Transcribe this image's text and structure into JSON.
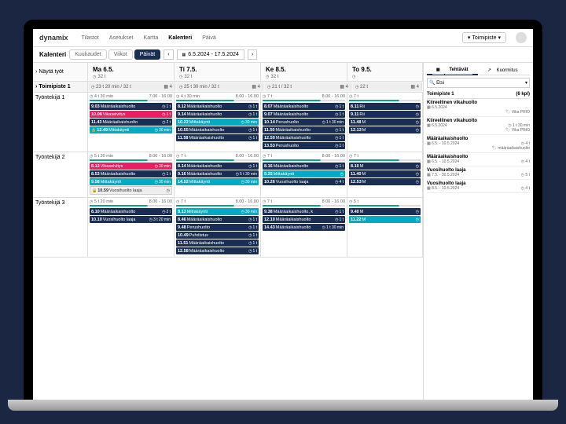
{
  "logo": "dynamix",
  "topnav": [
    "Tilastot",
    "Asetukset",
    "Kartta",
    "Kalenteri",
    "Päivä"
  ],
  "topnav_active": 3,
  "toimipiste_btn": "Toimipiste",
  "subbar": {
    "title": "Kalenteri",
    "tabs": [
      "Kuukaudet",
      "Viikot",
      "Päivät"
    ],
    "active": 2,
    "date": "6.5.2024 - 17.5.2024"
  },
  "show_label": "Näytä työt",
  "side": {
    "tabs": [
      "Tehtävät",
      "Kuormitus"
    ],
    "search": "Etsi",
    "hdr": {
      "name": "Toimipiste 1",
      "count": "(6 kpl)"
    },
    "items": [
      {
        "t": "Kiireellinen vikahuolto",
        "d": "6.5.2024",
        "b": "Vika PRIO"
      },
      {
        "t": "Kiireellinen vikahuolto",
        "d": "6.5.2024",
        "dur": "1 t 30 min",
        "b": "Vika PRIO"
      },
      {
        "t": "Määräaikaishuolto",
        "d": "6.5. - 10.5.2024",
        "dur": "4 t",
        "b": "määräaikaishuolto"
      },
      {
        "t": "Määräaikaishuolto",
        "d": "6.5. - 10.5.2024",
        "dur": "4 t"
      },
      {
        "t": "Vuosihuolto laaja",
        "d": "7.5. - 30.5.2024",
        "dur": "5 t"
      },
      {
        "t": "Vuosihuolto laaja",
        "d": "8.5. - 10.5.2024",
        "dur": "4 t"
      }
    ]
  },
  "days": [
    {
      "name": "Ma 6.5.",
      "time": "32 t"
    },
    {
      "name": "Ti 7.5.",
      "time": "32 t"
    },
    {
      "name": "Ke 8.5.",
      "time": "32 t"
    },
    {
      "name": "To 9.5.",
      "time": ""
    }
  ],
  "location": "Toimipiste 1",
  "stats": [
    "23 t 20 min / 32 t",
    "25 t 30 min / 32 t",
    "21 t / 32 t",
    "22 t"
  ],
  "stats_icon": "4",
  "workers": [
    {
      "name": "Työntekijä 1",
      "cols": [
        {
          "hdr": "4 t 30 min   7.00 - 16.00",
          "tasks": [
            {
              "tm": "9.03",
              "n": "Määräaikaishuolto",
              "d": "1 t",
              "c": "navy"
            },
            {
              "tm": "10.08",
              "n": "Vikaselvitys",
              "d": "1 t",
              "c": "pink"
            },
            {
              "tm": "11.43",
              "n": "Määräaikaishuolto",
              "d": "2 t",
              "c": "navy"
            },
            {
              "tm": "13.49",
              "n": "Mittakäynti",
              "d": "30 min",
              "c": "teal",
              "lock": true
            }
          ]
        },
        {
          "hdr": "4 t 30 min   8.00 - 16.00",
          "tasks": [
            {
              "tm": "8.12",
              "n": "Määräaikaishuolto",
              "d": "1 t",
              "c": "navy"
            },
            {
              "tm": "9.14",
              "n": "Määräaikaishuolto",
              "d": "1 t",
              "c": "navy"
            },
            {
              "tm": "10.22",
              "n": "Mittakäynti",
              "d": "30 min",
              "c": "teal"
            },
            {
              "tm": "10.55",
              "n": "Määräaikaishuolto",
              "d": "1 t",
              "c": "navy"
            },
            {
              "tm": "11.58",
              "n": "Määräaikaishuolto",
              "d": "1 t",
              "c": "navy"
            }
          ]
        },
        {
          "hdr": "7 t   8.00 - 16.00",
          "tasks": [
            {
              "tm": "8.07",
              "n": "Määräaikaishuolto",
              "d": "1 t",
              "c": "navy"
            },
            {
              "tm": "9.07",
              "n": "Määräaikaishuolto",
              "d": "1 t",
              "c": "navy"
            },
            {
              "tm": "10.14",
              "n": "Perushuolto",
              "d": "1 t 30 min",
              "c": "navy"
            },
            {
              "tm": "11.50",
              "n": "Määräaikaishuolto",
              "d": "1 t",
              "c": "navy"
            },
            {
              "tm": "12.50",
              "n": "Määräaikaishuolto",
              "d": "1 t",
              "c": "navy"
            },
            {
              "tm": "13.53",
              "n": "Perushuolto",
              "d": "1 t",
              "c": "navy"
            }
          ]
        },
        {
          "hdr": "7 t",
          "tasks": [
            {
              "tm": "8.11",
              "n": "Rii",
              "c": "navy"
            },
            {
              "tm": "9.11",
              "n": "Rii",
              "c": "navy"
            },
            {
              "tm": "11.48",
              "n": "M",
              "c": "navy"
            },
            {
              "tm": "12.13",
              "n": "M",
              "c": "navy"
            }
          ]
        }
      ]
    },
    {
      "name": "Työntekijä 2",
      "cols": [
        {
          "hdr": "5 t 30 min   8.00 - 16.00",
          "tasks": [
            {
              "tm": "8.13",
              "n": "Vikaselvitys",
              "d": "30 min",
              "c": "pink"
            },
            {
              "tm": "8.53",
              "n": "Määräaikaishuolto",
              "d": "1 t",
              "c": "navy"
            },
            {
              "tm": "9.58",
              "n": "Mittakäynti",
              "d": "30 min",
              "c": "teal"
            },
            {
              "tm": "10.59",
              "n": "Vuosihuolto laaja",
              "d": "",
              "c": "gray",
              "lock": true
            }
          ]
        },
        {
          "hdr": "7 t   8.00 - 16.00",
          "tasks": [
            {
              "tm": "8.14",
              "n": "Määräaikaishuolto",
              "d": "1 t",
              "c": "navy"
            },
            {
              "tm": "9.16",
              "n": "Määräaikaishuolto",
              "d": "5 t 30 min",
              "c": "navy"
            },
            {
              "tm": "14.52",
              "n": "Mittakäynti",
              "d": "30 min",
              "c": "teal"
            }
          ]
        },
        {
          "hdr": "7 t   8.00 - 16.00",
          "tasks": [
            {
              "tm": "8.16",
              "n": "Määräaikaishuolto",
              "d": "1 t",
              "c": "navy"
            },
            {
              "tm": "9.25",
              "n": "Mittakäynti",
              "d": "",
              "c": "teal"
            },
            {
              "tm": "10.26",
              "n": "Vuosihuolto laaja",
              "d": "4 t",
              "c": "navy"
            }
          ]
        },
        {
          "hdr": "7 t",
          "tasks": [
            {
              "tm": "8.10",
              "n": "M",
              "c": "navy"
            },
            {
              "tm": "11.40",
              "n": "M",
              "c": "navy"
            },
            {
              "tm": "12.53",
              "n": "M",
              "c": "navy"
            }
          ]
        }
      ]
    },
    {
      "name": "Työntekijä 3",
      "cols": [
        {
          "hdr": "5 t 20 min   8.00 - 16.00",
          "tasks": [
            {
              "tm": "8.10",
              "n": "Määräaikaishuolto",
              "d": "2 t",
              "c": "navy"
            },
            {
              "tm": "10.10",
              "n": "Vuosihuolto laaja",
              "d": "3 t 20 min",
              "c": "navy"
            }
          ]
        },
        {
          "hdr": "7 t   8.00 - 16.00",
          "tasks": [
            {
              "tm": "8.13",
              "n": "Mittakäynti",
              "d": "30 min",
              "c": "teal"
            },
            {
              "tm": "8.46",
              "n": "Määräaikaishuolto",
              "d": "1 t",
              "c": "navy"
            },
            {
              "tm": "9.48",
              "n": "Perushuolto",
              "d": "1 t",
              "c": "navy"
            },
            {
              "tm": "10.49",
              "n": "Puhdistus",
              "d": "1 t",
              "c": "navy"
            },
            {
              "tm": "11.51",
              "n": "Määräaikaishuolto",
              "d": "1 t",
              "c": "navy"
            },
            {
              "tm": "12.58",
              "n": "Määräaikaishuolto",
              "d": "1 t",
              "c": "navy"
            }
          ]
        },
        {
          "hdr": "7 t   8.00 - 16.00",
          "tasks": [
            {
              "tm": "9.38",
              "n": "Määräaikaishuolto, k",
              "d": "1 t",
              "c": "navy"
            },
            {
              "tm": "12.10",
              "n": "Määräaikaishuolto",
              "d": "1 t",
              "c": "navy"
            },
            {
              "tm": "14.43",
              "n": "Määräaikaishuolto",
              "d": "1 t 30 min",
              "c": "navy"
            }
          ]
        },
        {
          "hdr": "5 t",
          "tasks": [
            {
              "tm": "9.40",
              "n": "M",
              "c": "navy"
            },
            {
              "tm": "11.22",
              "n": "M",
              "c": "teal"
            }
          ]
        }
      ]
    }
  ]
}
